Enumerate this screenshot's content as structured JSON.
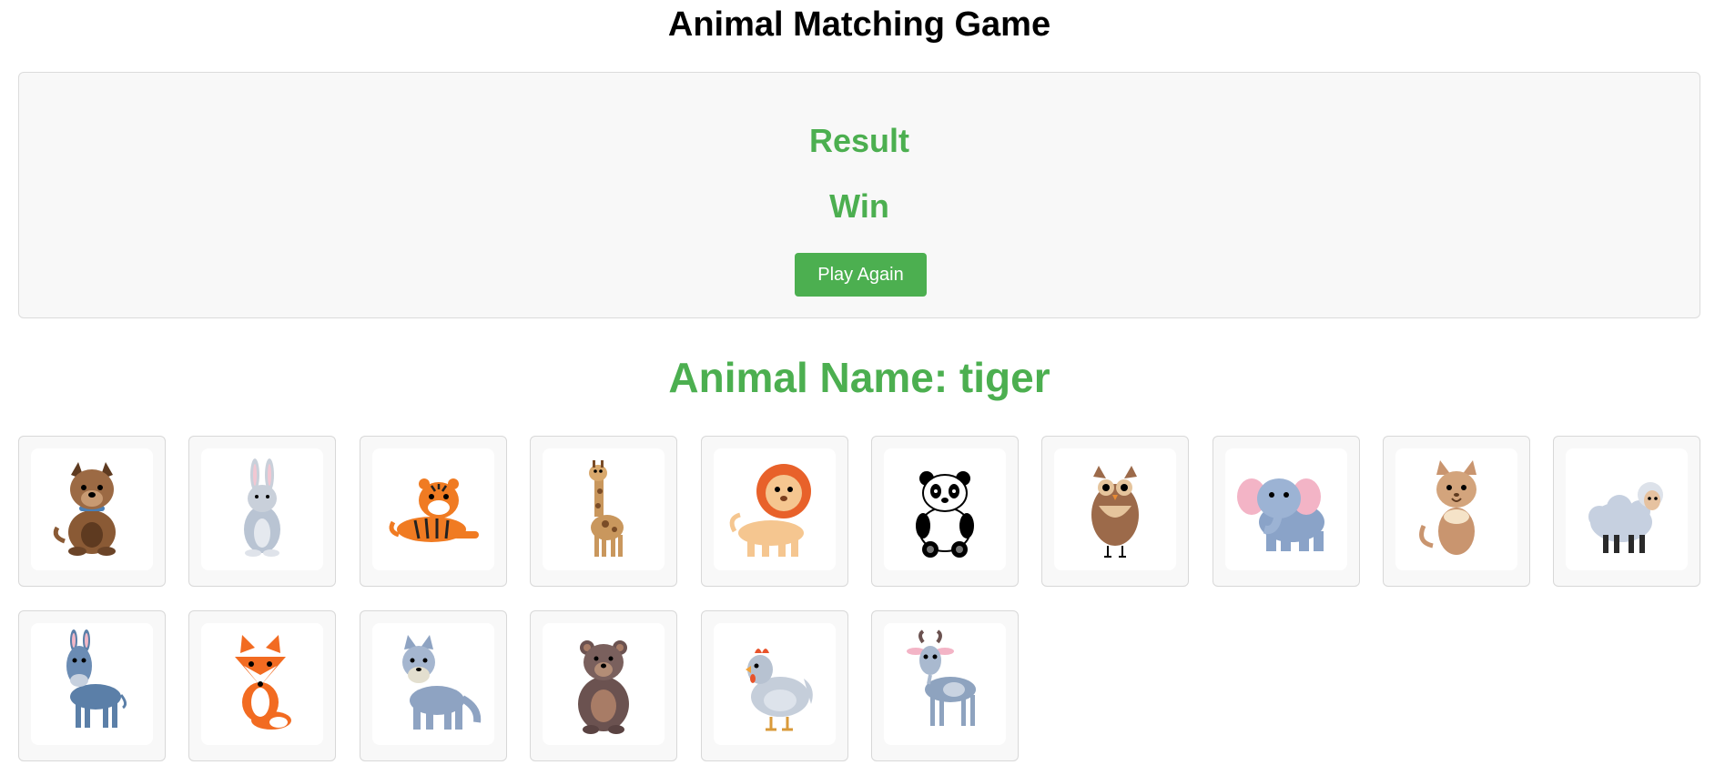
{
  "header": {
    "title": "Animal Matching Game"
  },
  "result_panel": {
    "heading": "Result",
    "value": "Win",
    "button_label": "Play Again"
  },
  "prompt": {
    "animal_name_label": "Animal Name: tiger"
  },
  "cards": [
    {
      "animal": "dog"
    },
    {
      "animal": "rabbit"
    },
    {
      "animal": "tiger"
    },
    {
      "animal": "giraffe"
    },
    {
      "animal": "lion"
    },
    {
      "animal": "panda"
    },
    {
      "animal": "owl"
    },
    {
      "animal": "elephant"
    },
    {
      "animal": "cat"
    },
    {
      "animal": "sheep"
    },
    {
      "animal": "donkey"
    },
    {
      "animal": "fox"
    },
    {
      "animal": "wolf"
    },
    {
      "animal": "bear"
    },
    {
      "animal": "chicken"
    },
    {
      "animal": "goat"
    }
  ],
  "colors": {
    "accent": "#4caf50",
    "panel_bg": "#f8f8f8"
  }
}
